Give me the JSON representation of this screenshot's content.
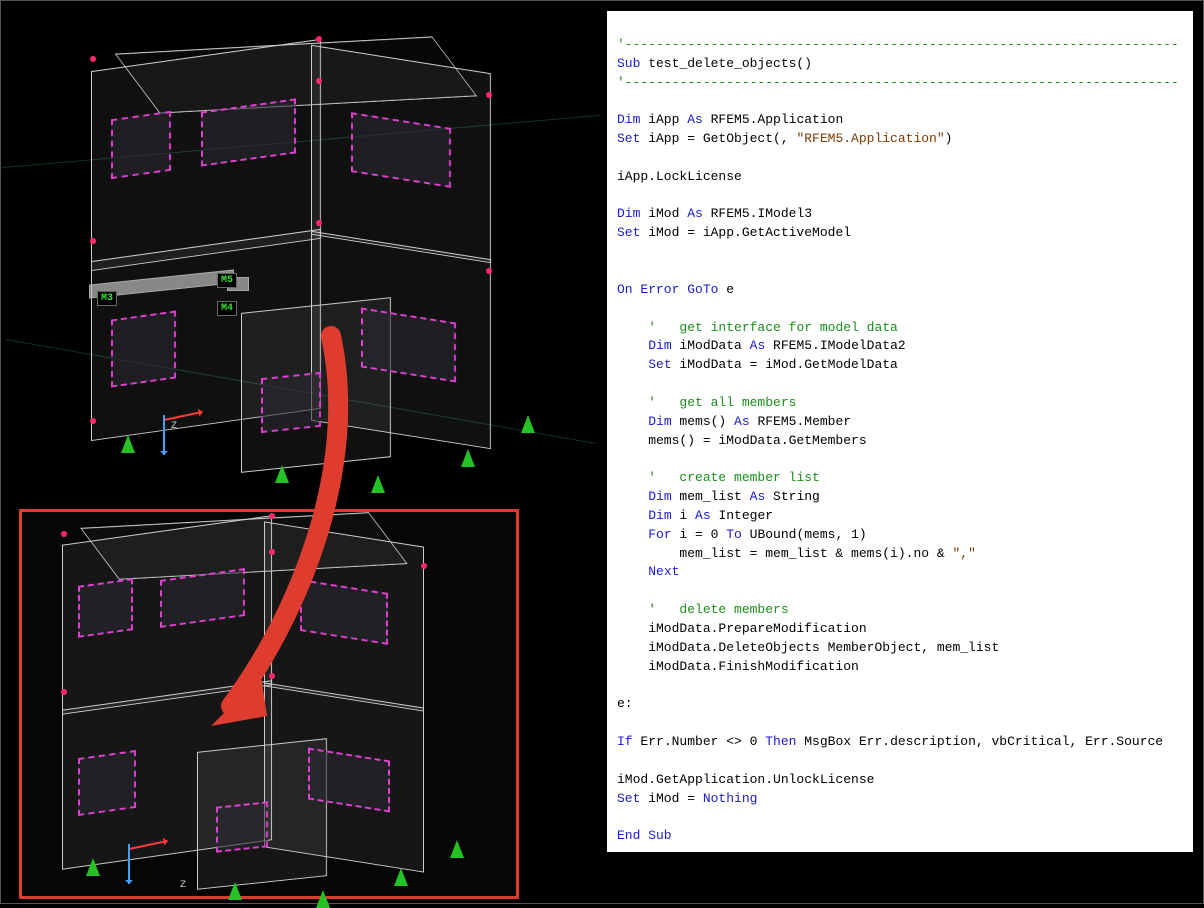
{
  "member_labels": {
    "m3": "M3",
    "m4": "M4",
    "m5": "M5"
  },
  "axis_labels": {
    "z_top": "Z",
    "z_bottom": "Z"
  },
  "code": {
    "sep": "'-----------------------------------------------------------------------",
    "sub_open_kw": "Sub",
    "sub_name": " test_delete_objects()",
    "dim": "Dim",
    "set": "Set",
    "as": "As",
    "nothing": "Nothing",
    "iapp_decl": " iApp ",
    "iapp_type": " RFEM5.Application",
    "iapp_assign": " iApp = GetObject(, ",
    "iapp_str": "\"RFEM5.Application\"",
    "iapp_end": ")",
    "locklic": "iApp.LockLicense",
    "imod_decl": " iMod ",
    "imod_type": " RFEM5.IModel3",
    "imod_assign": " iMod = iApp.GetActiveModel",
    "onerr_a": "On Error GoTo",
    "onerr_b": " e",
    "c1": "'   get interface for model data",
    "imoddata_decl": " iModData ",
    "imoddata_type": " RFEM5.IModelData2",
    "imoddata_assign": " iModData = iMod.GetModelData",
    "c2": "'   get all members",
    "mems_decl": " mems() ",
    "mems_type": " RFEM5.Member",
    "mems_assign": "    mems() = iModData.GetMembers",
    "c3": "'   create member list",
    "memlist_decl": " mem_list ",
    "memlist_type": " String",
    "i_decl": " i ",
    "i_type": " Integer",
    "for_a": "For",
    "for_b": " i = 0 ",
    "for_c": "To",
    "for_d": " UBound(mems, 1)",
    "loopbody": "        mem_list = mem_list & mems(i).no & ",
    "loopstr": "\",\"",
    "next": "Next",
    "c4": "'   delete members",
    "prep": "    iModData.PrepareModification",
    "del": "    iModData.DeleteObjects MemberObject, mem_list",
    "fin": "    iModData.FinishModification",
    "elabel": "e:",
    "if_a": "If",
    "if_b": " Err.Number <> 0 ",
    "if_c": "Then",
    "if_d": " MsgBox Err.description, vbCritical, Err.Source",
    "unlock": "iMod.GetApplication.UnlockLicense",
    "setnothing": " iMod = ",
    "endsub": "End Sub"
  }
}
